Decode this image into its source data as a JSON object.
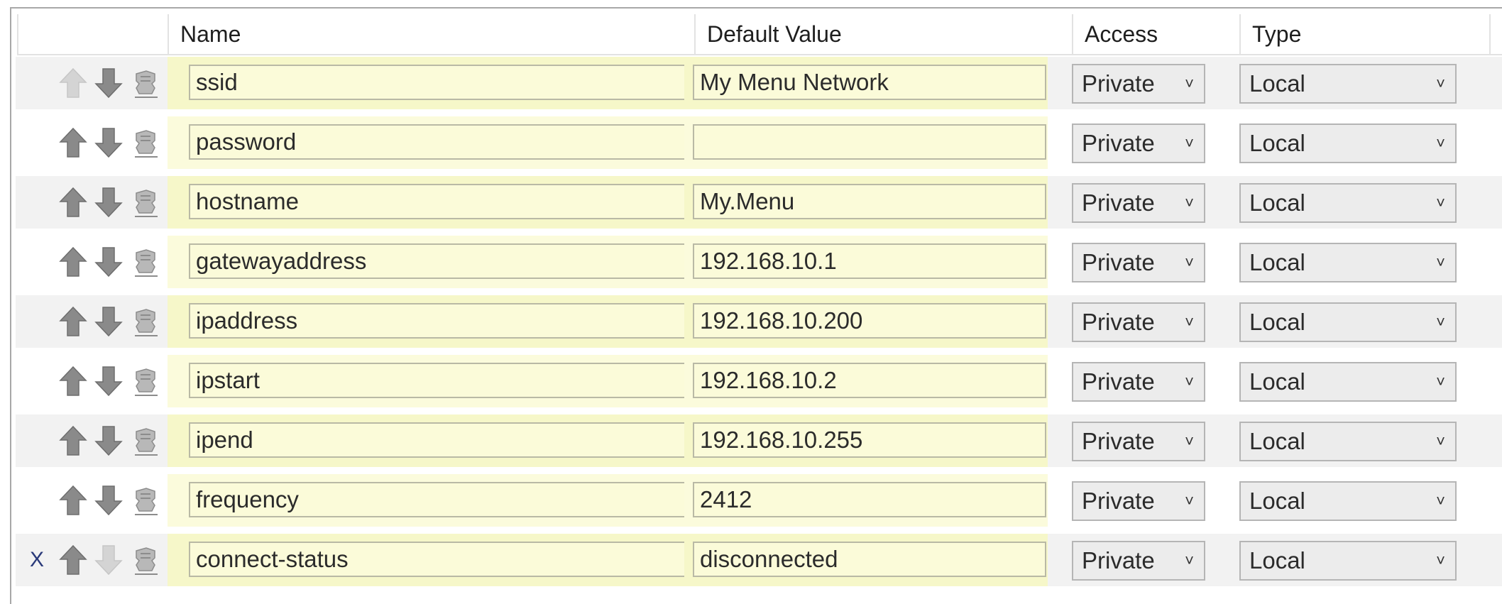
{
  "columns": {
    "name": "Name",
    "default_value": "Default Value",
    "access": "Access",
    "type": "Type"
  },
  "rows": [
    {
      "name": "ssid",
      "value": "My Menu Network",
      "access": "Private",
      "type": "Local",
      "x_mark": "",
      "up_enabled": false,
      "down_enabled": true
    },
    {
      "name": "password",
      "value": "",
      "access": "Private",
      "type": "Local",
      "x_mark": "",
      "up_enabled": true,
      "down_enabled": true
    },
    {
      "name": "hostname",
      "value": "My.Menu",
      "access": "Private",
      "type": "Local",
      "x_mark": "",
      "up_enabled": true,
      "down_enabled": true
    },
    {
      "name": "gatewayaddress",
      "value": "192.168.10.1",
      "access": "Private",
      "type": "Local",
      "x_mark": "",
      "up_enabled": true,
      "down_enabled": true
    },
    {
      "name": "ipaddress",
      "value": "192.168.10.200",
      "access": "Private",
      "type": "Local",
      "x_mark": "",
      "up_enabled": true,
      "down_enabled": true
    },
    {
      "name": "ipstart",
      "value": "192.168.10.2",
      "access": "Private",
      "type": "Local",
      "x_mark": "",
      "up_enabled": true,
      "down_enabled": true
    },
    {
      "name": "ipend",
      "value": "192.168.10.255",
      "access": "Private",
      "type": "Local",
      "x_mark": "",
      "up_enabled": true,
      "down_enabled": true
    },
    {
      "name": "frequency",
      "value": "2412",
      "access": "Private",
      "type": "Local",
      "x_mark": "",
      "up_enabled": true,
      "down_enabled": true
    },
    {
      "name": "connect-status",
      "value": "disconnected",
      "access": "Private",
      "type": "Local",
      "x_mark": "X",
      "up_enabled": true,
      "down_enabled": false
    }
  ],
  "icons": {
    "move_up": "arrow-up-icon",
    "move_down": "arrow-down-icon",
    "remove": "remove-item-icon",
    "dropdown": "chevron-down-icon"
  },
  "colors": {
    "highlight_yellow": "#f6f7c9",
    "field_yellow": "#fbfbd9",
    "shaded_row": "#f2f2f2",
    "x_mark": "#2a3a7a"
  }
}
